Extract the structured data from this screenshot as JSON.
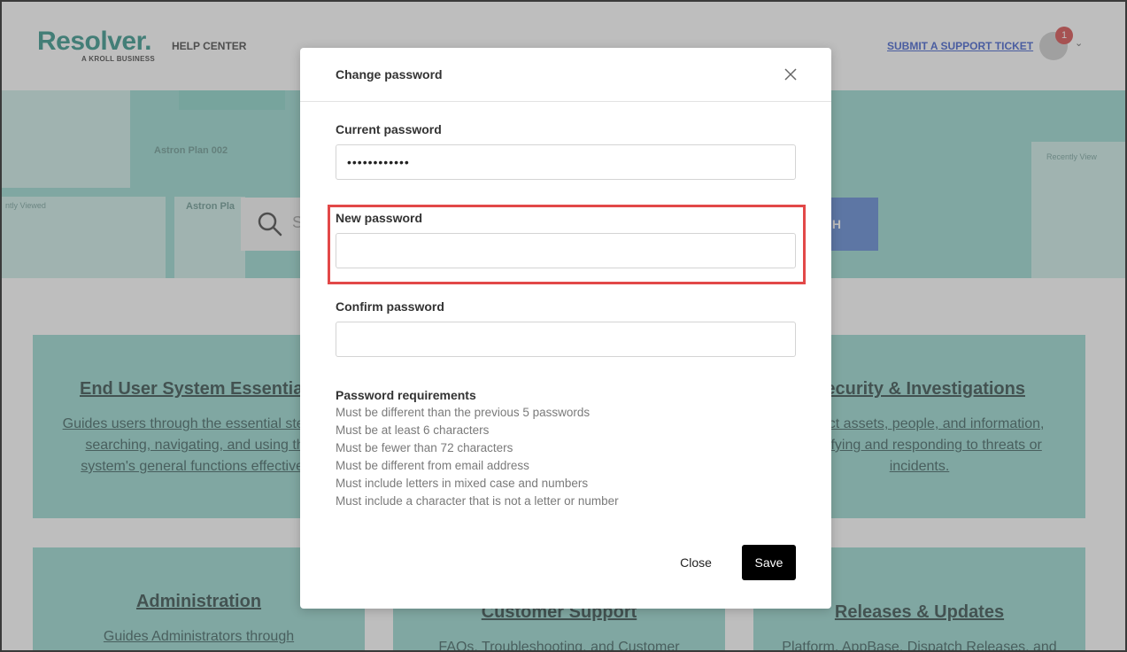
{
  "header": {
    "logo": "Resolver.",
    "logo_sub": "A KROLL BUSINESS",
    "help_center": "HELP CENTER",
    "submit_ticket": "SUBMIT A SUPPORT TICKET",
    "notification_count": "1"
  },
  "hero": {
    "pill_1": "Astron Plan 002",
    "pill_2": "Astron Pla",
    "recently_viewed_left": "ntly Viewed",
    "recently_viewed_right": "Recently View",
    "search_placeholder": "S",
    "search_button": "H"
  },
  "topics": [
    {
      "title": "End User System Essentials",
      "desc": "Guides users through the essential steps of searching, navigating, and using the system's general functions effectively."
    },
    {
      "title": "Security & Investigations",
      "desc": "Protect assets, people, and information, identifying and responding to threats or incidents."
    },
    {
      "title": "Administration",
      "desc": "Guides Administrators through"
    },
    {
      "title": "Customer Support",
      "desc": "FAQs, Troubleshooting, and Customer"
    },
    {
      "title": "Releases & Updates",
      "desc": "Platform, AppBase, Dispatch Releases, and"
    }
  ],
  "modal": {
    "title": "Change password",
    "current_label": "Current password",
    "current_value": "••••••••••••",
    "new_label": "New password",
    "new_value": "",
    "confirm_label": "Confirm password",
    "confirm_value": "",
    "requirements_title": "Password requirements",
    "requirements": [
      "Must be different than the previous 5 passwords",
      "Must be at least 6 characters",
      "Must be fewer than 72 characters",
      "Must be different from email address",
      "Must include letters in mixed case and numbers",
      "Must include a character that is not a letter or number"
    ],
    "close_label": "Close",
    "save_label": "Save"
  },
  "colors": {
    "brand": "#1f8a7f",
    "teal_card": "#8fd6cc",
    "highlight": "#e24848",
    "save_bg": "#000000"
  },
  "icons": [
    "search-icon",
    "close-icon",
    "chevron-down-icon",
    "avatar"
  ]
}
